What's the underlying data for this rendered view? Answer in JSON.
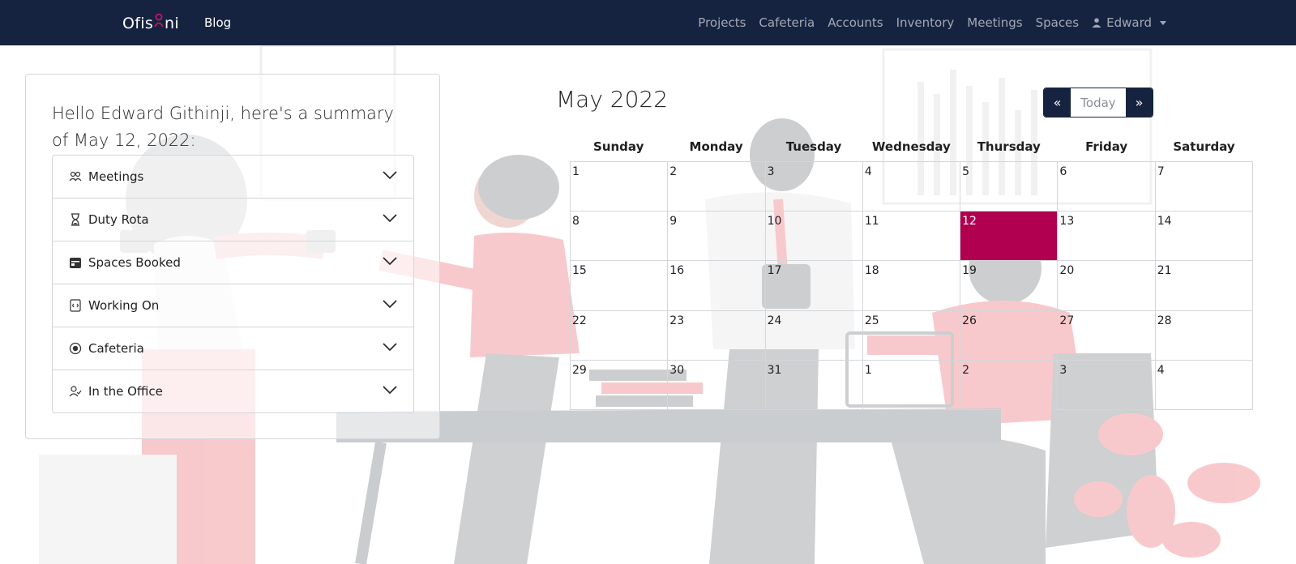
{
  "navbar": {
    "brand_prefix": "Ofis",
    "brand_suffix": "ni",
    "blog": "Blog",
    "links": [
      "Projects",
      "Cafeteria",
      "Accounts",
      "Inventory",
      "Meetings",
      "Spaces"
    ],
    "user": "Edward"
  },
  "summary": {
    "greeting": "Hello Edward Githinji, here's a summary of May 12, 2022:",
    "items": [
      {
        "label": "Meetings",
        "icon": "people-icon"
      },
      {
        "label": "Duty Rota",
        "icon": "hourglass-icon"
      },
      {
        "label": "Spaces Booked",
        "icon": "calendar-card-icon"
      },
      {
        "label": "Working On",
        "icon": "code-file-icon"
      },
      {
        "label": "Cafeteria",
        "icon": "badge-icon"
      },
      {
        "label": "In the Office",
        "icon": "person-check-icon"
      }
    ]
  },
  "calendar": {
    "title": "May 2022",
    "prev": "«",
    "today": "Today",
    "next": "»",
    "weekdays": [
      "Sunday",
      "Monday",
      "Tuesday",
      "Wednesday",
      "Thursday",
      "Friday",
      "Saturday"
    ],
    "weeks": [
      [
        "1",
        "2",
        "3",
        "4",
        "5",
        "6",
        "7"
      ],
      [
        "8",
        "9",
        "10",
        "11",
        "12",
        "13",
        "14"
      ],
      [
        "15",
        "16",
        "17",
        "18",
        "19",
        "20",
        "21"
      ],
      [
        "22",
        "23",
        "24",
        "25",
        "26",
        "27",
        "28"
      ],
      [
        "29",
        "30",
        "31",
        "1",
        "2",
        "3",
        "4"
      ]
    ],
    "selected": "12",
    "accent": "#b0004f"
  },
  "colors": {
    "navbar": "#162340",
    "today_cell": "#b0004f"
  }
}
